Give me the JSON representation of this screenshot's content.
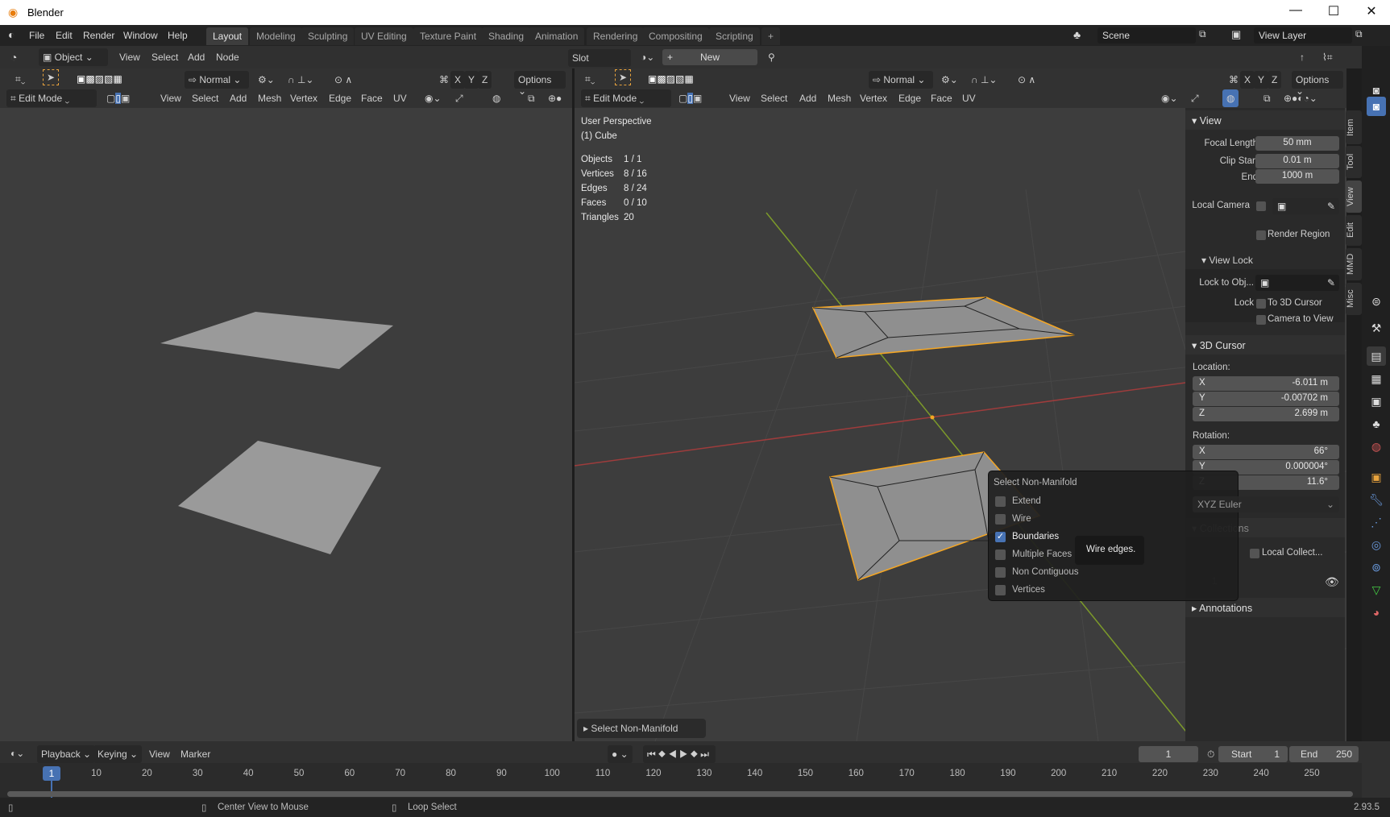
{
  "window": {
    "title": "Blender",
    "minimize": "—",
    "maximize": "☐",
    "close": "✕"
  },
  "menu": [
    "File",
    "Edit",
    "Render",
    "Window",
    "Help"
  ],
  "workspaces": [
    "Layout",
    "Modeling",
    "Sculpting",
    "UV Editing",
    "Texture Paint",
    "Shading",
    "Animation",
    "Rendering",
    "Compositing",
    "Scripting"
  ],
  "workspace_add": "+",
  "scene": {
    "name": "Scene",
    "view_layer": "View Layer"
  },
  "shader_header": {
    "mode": "Object",
    "menus": [
      "View",
      "Select",
      "Add",
      "Node"
    ],
    "slot": "Slot",
    "new_label": "New",
    "new_plus": "+"
  },
  "viewport_header": {
    "orientation": "Normal",
    "options": "Options",
    "axes": [
      "X",
      "Y",
      "Z"
    ],
    "mode": "Edit Mode",
    "menus": [
      "View",
      "Select",
      "Add",
      "Mesh",
      "Vertex",
      "Edge",
      "Face",
      "UV"
    ]
  },
  "overlay": {
    "perspective": "User Perspective",
    "object": "(1) Cube",
    "stats": [
      {
        "label": "Objects",
        "value": "1 / 1"
      },
      {
        "label": "Vertices",
        "value": "8 / 16"
      },
      {
        "label": "Edges",
        "value": "8 / 24"
      },
      {
        "label": "Faces",
        "value": "0 / 10"
      },
      {
        "label": "Triangles",
        "value": "20"
      }
    ]
  },
  "npanel": {
    "view_title": "View",
    "focal_length_label": "Focal Length",
    "focal_length": "50 mm",
    "clip_start_label": "Clip Start",
    "clip_start": "0.01 m",
    "end_label": "End",
    "clip_end": "1000 m",
    "local_camera": "Local Camera",
    "render_region": "Render Region",
    "view_lock": "View Lock",
    "lock_to_obj": "Lock to Obj...",
    "lock": "Lock",
    "to_3d_cursor": "To 3D Cursor",
    "camera_to_view": "Camera to View",
    "cursor_title": "3D Cursor",
    "location": "Location:",
    "loc": [
      {
        "axis": "X",
        "value": "-6.011 m"
      },
      {
        "axis": "Y",
        "value": "-0.00702 m"
      },
      {
        "axis": "Z",
        "value": "2.699 m"
      }
    ],
    "rotation": "Rotation:",
    "rot": [
      {
        "axis": "X",
        "value": "66°"
      },
      {
        "axis": "Y",
        "value": "0.000004°"
      },
      {
        "axis": "Z",
        "value": "11.6°"
      }
    ],
    "rotation_mode": "XYZ Euler",
    "collections": "Collections",
    "local_collections": "Local Collect...",
    "collection_count": "1",
    "annotations": "Annotations"
  },
  "sidebar_tabs": [
    "Item",
    "Tool",
    "View",
    "Edit",
    "MMD",
    "Misc"
  ],
  "active_sidebar_tab": "View",
  "popup": {
    "title": "Select Non-Manifold",
    "options": [
      {
        "label": "Extend",
        "checked": false
      },
      {
        "label": "Wire",
        "checked": false
      },
      {
        "label": "Boundaries",
        "checked": true
      },
      {
        "label": "Multiple Faces",
        "checked": false
      },
      {
        "label": "Non Contiguous",
        "checked": false
      },
      {
        "label": "Vertices",
        "checked": false
      }
    ],
    "tooltip": "Wire edges."
  },
  "redo_panel": "Select Non-Manifold",
  "timeline": {
    "menus": [
      "Playback",
      "Keying",
      "View",
      "Marker"
    ],
    "current_frame": "1",
    "start_label": "Start",
    "start": "1",
    "end_label": "End",
    "end": "250",
    "ticks": [
      "10",
      "20",
      "30",
      "40",
      "50",
      "60",
      "70",
      "80",
      "90",
      "100",
      "110",
      "120",
      "130",
      "140",
      "150",
      "160",
      "170",
      "180",
      "190",
      "200",
      "210",
      "220",
      "230",
      "240",
      "250"
    ]
  },
  "status": {
    "center_view": "Center View to Mouse",
    "loop_select": "Loop Select",
    "version": "2.93.5"
  },
  "colors": {
    "accent": "#4772b3",
    "selection": "#f5a623",
    "x_axis": "#9e3c3c",
    "y_axis": "#7c9a2a"
  }
}
